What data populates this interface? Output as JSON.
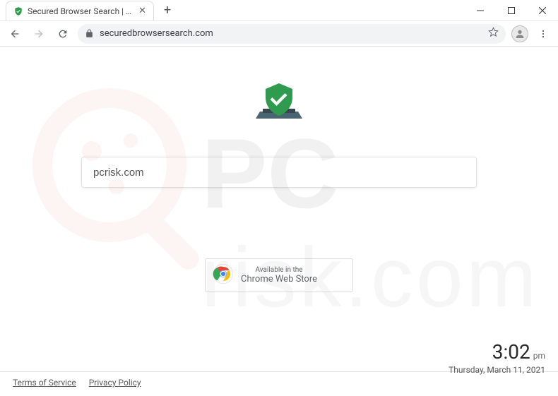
{
  "window": {
    "tab_title": "Secured Browser Search | Search",
    "close_glyph": "✕",
    "plus_glyph": "+"
  },
  "toolbar": {
    "url": "securedbrowsersearch.com"
  },
  "page": {
    "search_value": "pcrisk.com",
    "watermark_text": "pcrisk.com"
  },
  "store": {
    "line1": "Available in the",
    "line2": "Chrome Web Store"
  },
  "clock": {
    "time": "3:02",
    "ampm": "pm",
    "date": "Thursday, March 11, 2021"
  },
  "footer": {
    "terms": "Terms of Service",
    "privacy": "Privacy Policy"
  }
}
